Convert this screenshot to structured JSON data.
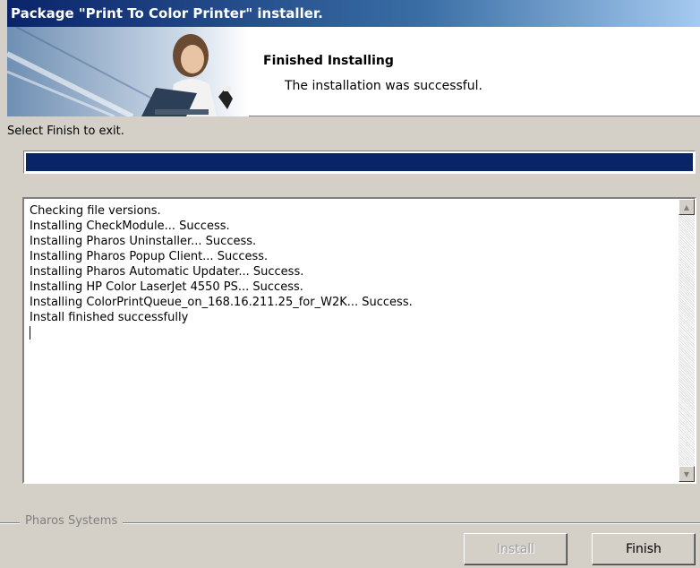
{
  "window": {
    "title": "Package \"Print To Color Printer\" installer."
  },
  "banner": {
    "heading": "Finished Installing",
    "subheading": "The installation was successful."
  },
  "status": {
    "text": "Select Finish to exit.",
    "progress": 1.0
  },
  "log": {
    "lines": [
      "Checking file versions.",
      "Installing CheckModule... Success.",
      "Installing Pharos Uninstaller... Success.",
      "Installing Pharos Popup Client... Success.",
      "Installing Pharos Automatic Updater... Success.",
      "Installing HP Color LaserJet 4550 PS... Success.",
      "Installing ColorPrintQueue_on_168.16.211.25_for_W2K... Success.",
      "Install finished successfully"
    ]
  },
  "footer": {
    "group_label": "Pharos Systems",
    "install_label": "Install",
    "finish_label": "Finish"
  },
  "colors": {
    "accent": "#0a246a",
    "window_bg": "#d4d0c8"
  }
}
